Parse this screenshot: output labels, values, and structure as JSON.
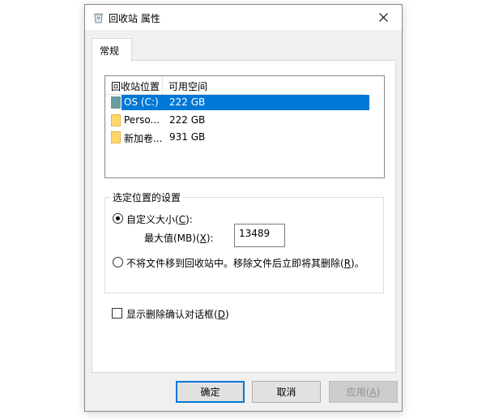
{
  "window": {
    "title": "回收站 属性",
    "close_icon": "close-icon",
    "app_icon": "recycle-bin-icon"
  },
  "tabs": [
    {
      "label": "常规"
    }
  ],
  "listview": {
    "columns": [
      "回收站位置",
      "可用空间"
    ],
    "rows": [
      {
        "name": "OS (C:)",
        "space": "222 GB",
        "icon": "drive-icon",
        "selected": true
      },
      {
        "name": "Perso...",
        "space": "222 GB",
        "icon": "folder-icon"
      },
      {
        "name": "新加卷...",
        "space": "931 GB",
        "icon": "folder-icon"
      }
    ]
  },
  "settings": {
    "group_label": "选定位置的设置",
    "custom_size": {
      "label": "自定义大小(",
      "key": "C",
      "suffix": "):",
      "checked": true
    },
    "max_size": {
      "label": "最大值(MB)(",
      "key": "X",
      "suffix": "):",
      "value": "13489"
    },
    "delete_immediately": {
      "label": "不将文件移到回收站中。移除文件后立即将其删除(",
      "key": "R",
      "suffix": ")。",
      "checked": false
    }
  },
  "confirm_dialog": {
    "label": "显示删除确认对话框(",
    "key": "D",
    "suffix": ")",
    "checked": false
  },
  "buttons": {
    "ok": "确定",
    "cancel": "取消",
    "apply": {
      "label": "应用(",
      "key": "A",
      "suffix": ")",
      "enabled": false
    }
  },
  "colors": {
    "selection": "#0078d7",
    "dialog_bg": "#f0f0f0"
  }
}
